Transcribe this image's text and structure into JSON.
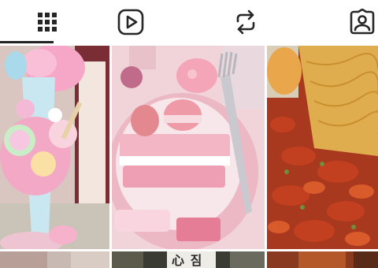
{
  "profile_tabs": [
    {
      "name": "tab-posts-grid",
      "icon": "grid-icon",
      "selected": true
    },
    {
      "name": "tab-reels",
      "icon": "play-icon",
      "selected": false
    },
    {
      "name": "tab-reposts",
      "icon": "repost-icon",
      "selected": false
    },
    {
      "name": "tab-tagged",
      "icon": "tagged-person-icon",
      "selected": false
    }
  ],
  "colors": {
    "icon": "#262626",
    "indicator": "#222222",
    "background": "#ffffff"
  },
  "posts": [
    {
      "subject": "pink-candy-milkshake-photo"
    },
    {
      "subject": "pink-dessert-plate-photo"
    },
    {
      "subject": "crawfish-and-noodles-photo"
    },
    {
      "subject": "partial-photo-1"
    },
    {
      "subject": "partial-photo-2",
      "overlay_text": "心 짐"
    },
    {
      "subject": "partial-photo-3"
    }
  ]
}
